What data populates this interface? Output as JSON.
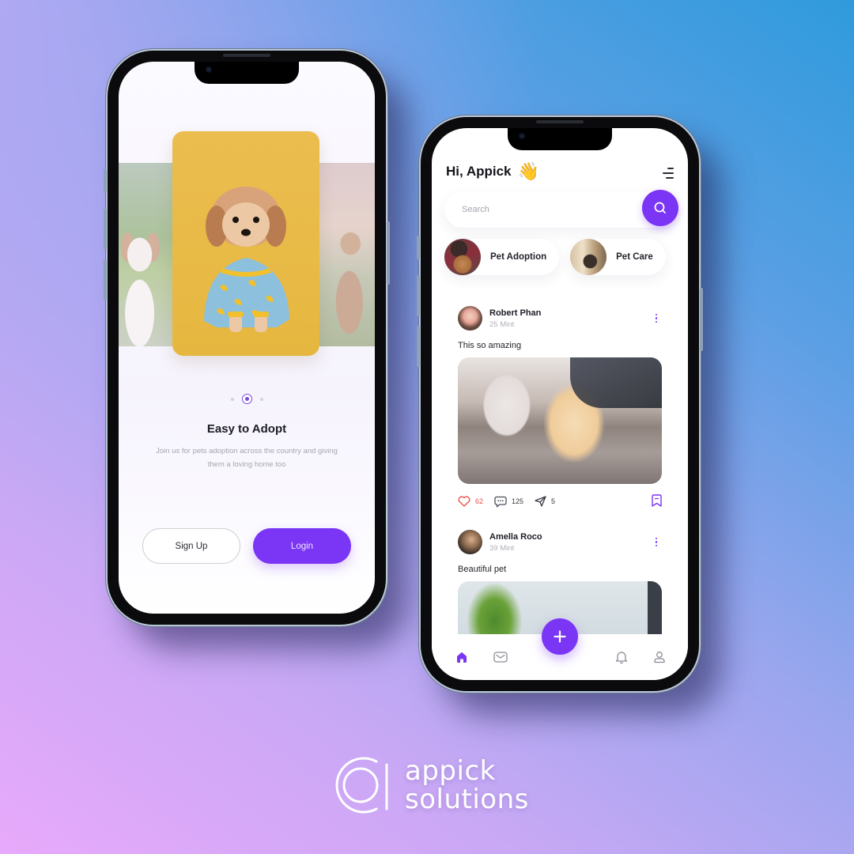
{
  "theme": {
    "accent": "#7a35f5",
    "like_color": "#e5534b",
    "background_gradient": [
      "#e8a9fb",
      "#2f9bdc"
    ]
  },
  "onboarding": {
    "carousel": {
      "images": [
        "dog-left-image",
        "dog-center-image",
        "dog-right-image"
      ],
      "active_index": 1,
      "page_count": 3
    },
    "title": "Easy to Adopt",
    "description": "Join us for pets adoption across the country and giving them a loving home too",
    "signup_label": "Sign Up",
    "login_label": "Login"
  },
  "home": {
    "greeting": "Hi, Appick",
    "greeting_emoji": "👋",
    "menu_icon": "menu-icon",
    "search": {
      "placeholder": "Search",
      "value": "",
      "icon": "search-icon"
    },
    "categories": [
      {
        "label": "Pet Adoption",
        "icon": "pet-adoption-avatar"
      },
      {
        "label": "Pet Care",
        "icon": "pet-care-avatar"
      }
    ],
    "posts": [
      {
        "author": "Robert Phan",
        "time": "25 Mint",
        "text": "This so amazing",
        "likes": "62",
        "comments": "125",
        "shares": "5"
      },
      {
        "author": "Amella Roco",
        "time": "39 Mint",
        "text": "Beautiful pet"
      }
    ],
    "tabbar": {
      "items": [
        "home-icon",
        "mail-icon",
        "add-icon",
        "bell-icon",
        "profile-icon"
      ],
      "active": "home-icon"
    }
  },
  "brand": {
    "line1": "appick",
    "line2": "solutions"
  }
}
